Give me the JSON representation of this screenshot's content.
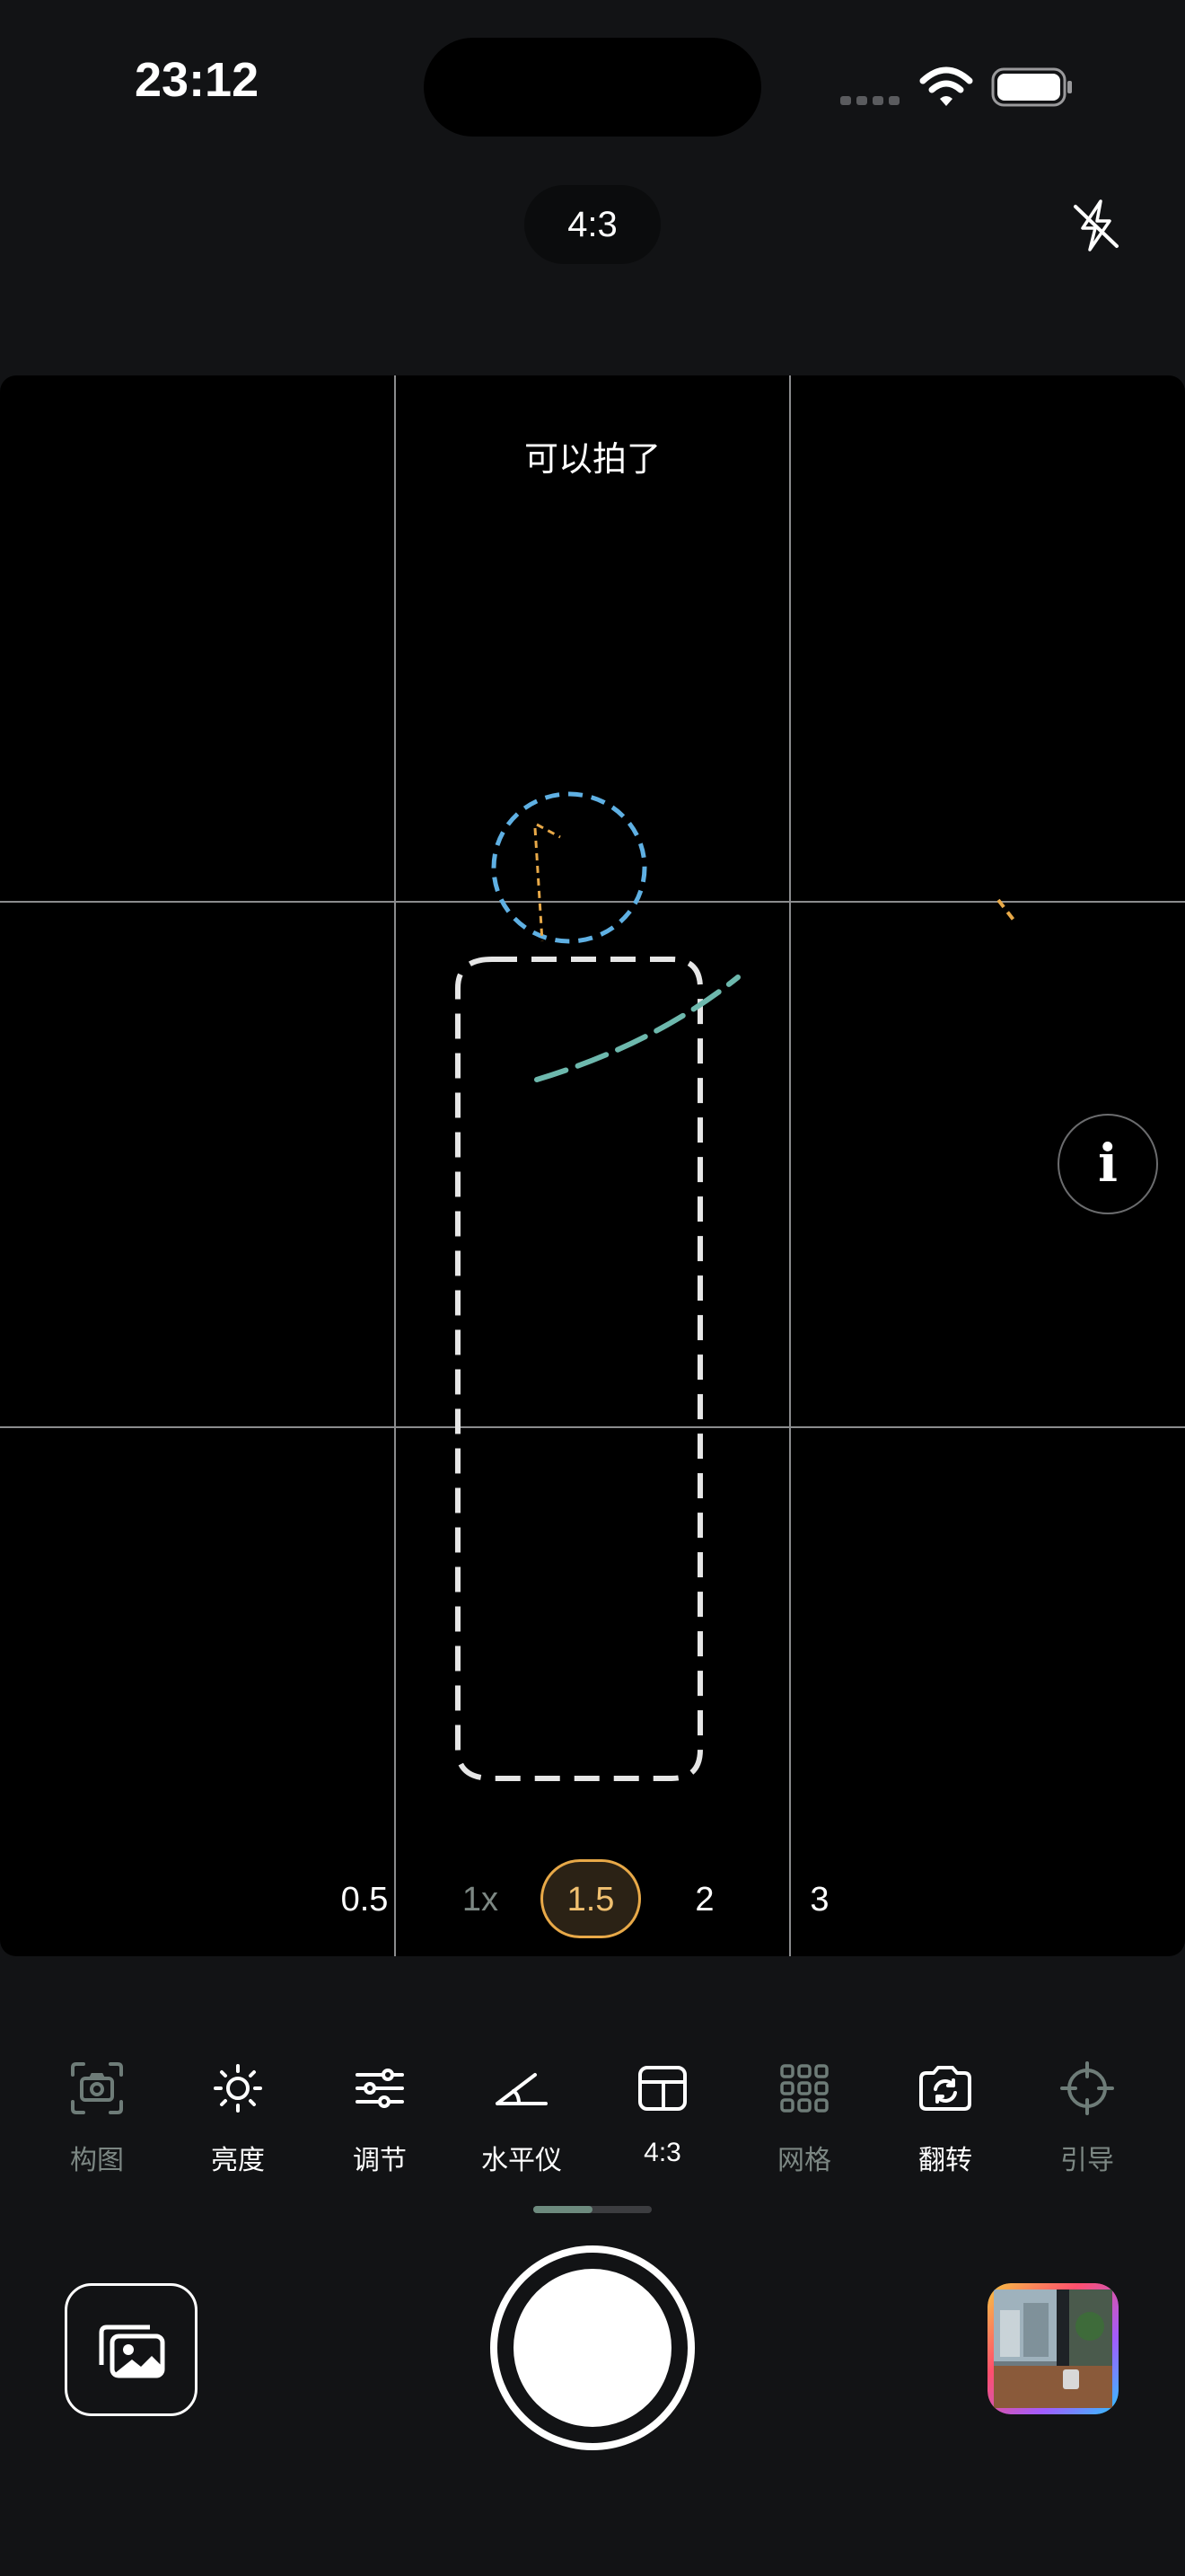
{
  "status_bar": {
    "time": "23:12"
  },
  "top": {
    "ratio": "4:3",
    "flash_state": "off"
  },
  "viewfinder": {
    "status_text": "可以拍了",
    "zoom_levels": [
      "0.5",
      "1x",
      "1.5",
      "2",
      "3"
    ],
    "selected_zoom": "1.5"
  },
  "toolbar": [
    {
      "label": "构图",
      "icon": "composition-icon"
    },
    {
      "label": "亮度",
      "icon": "sun-icon"
    },
    {
      "label": "调节",
      "icon": "sliders-icon"
    },
    {
      "label": "水平仪",
      "icon": "level-angle-icon"
    },
    {
      "label": "4:3",
      "icon": "aspect-ratio-icon"
    },
    {
      "label": "网格",
      "icon": "grid-icon"
    },
    {
      "label": "翻转",
      "icon": "flip-camera-icon"
    },
    {
      "label": "引导",
      "icon": "crosshair-icon"
    }
  ],
  "colors": {
    "accent": "#e8a948",
    "disabled": "#6e7c78",
    "guide_blue": "#5fb0e3",
    "guide_teal": "#6db8ad",
    "guide_orange": "#e8a948"
  }
}
